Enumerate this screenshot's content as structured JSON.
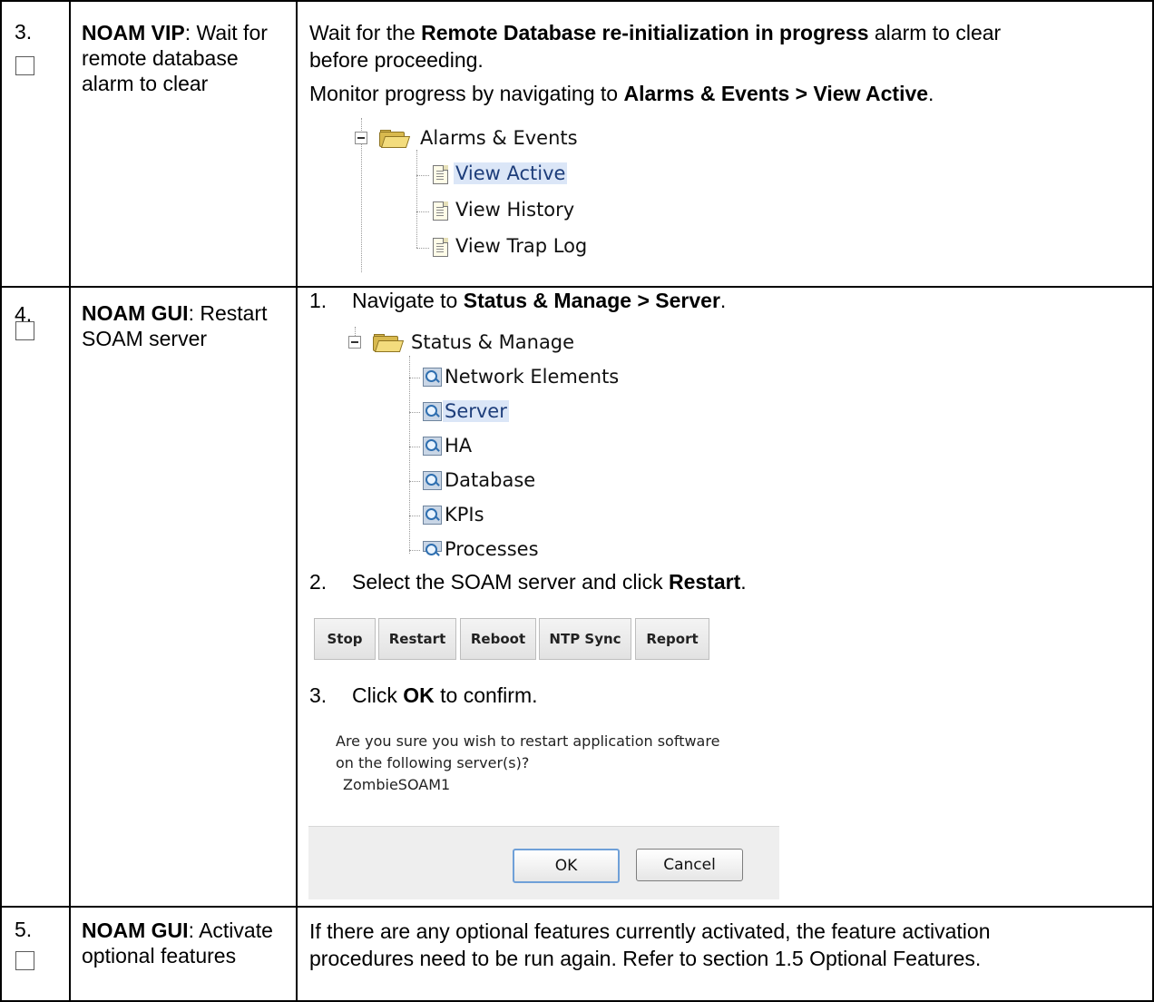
{
  "rows": [
    {
      "number": "3.",
      "title_bold": "NOAM VIP",
      "title_rest": ":  Wait for remote database alarm to clear",
      "para1_pre": "Wait for the ",
      "para1_bold": "Remote Database re-initialization in progress",
      "para1_post": " alarm to clear",
      "para1_line2": "before proceeding.",
      "para2_pre": "Monitor progress by navigating to ",
      "para2_bold": "Alarms & Events > View Active",
      "para2_post": ".",
      "tree": {
        "root": "Alarms & Events",
        "items": [
          "View Active",
          "View History",
          "View Trap Log"
        ]
      }
    },
    {
      "number": "4.",
      "title_bold": "NOAM GUI",
      "title_rest": ": Restart SOAM server",
      "steps": [
        {
          "num": "1.",
          "pre": "Navigate to ",
          "bold": "Status & Manage > Server",
          "post": "."
        },
        {
          "num": "2.",
          "pre": "Select the SOAM server and click ",
          "bold": "Restart",
          "post": "."
        },
        {
          "num": "3.",
          "pre": "Click ",
          "bold": "OK",
          "post": " to confirm."
        }
      ],
      "tree": {
        "root": "Status & Manage",
        "items": [
          "Network Elements",
          "Server",
          "HA",
          "Database",
          "KPIs",
          "Processes"
        ]
      },
      "buttons": [
        "Stop",
        "Restart",
        "Reboot",
        "NTP Sync",
        "Report"
      ],
      "dialog": {
        "line1": "Are you sure you wish to restart application software",
        "line2": "on the following server(s)?",
        "line3": "ZombieSOAM1",
        "ok": "OK",
        "cancel": "Cancel"
      }
    },
    {
      "number": "5.",
      "title_bold": "NOAM GUI",
      "title_rest": ": Activate optional features",
      "line1": "If there are any optional features currently activated, the feature activation",
      "line2": "procedures need to be run again.  Refer to section 1.5 Optional Features."
    }
  ]
}
